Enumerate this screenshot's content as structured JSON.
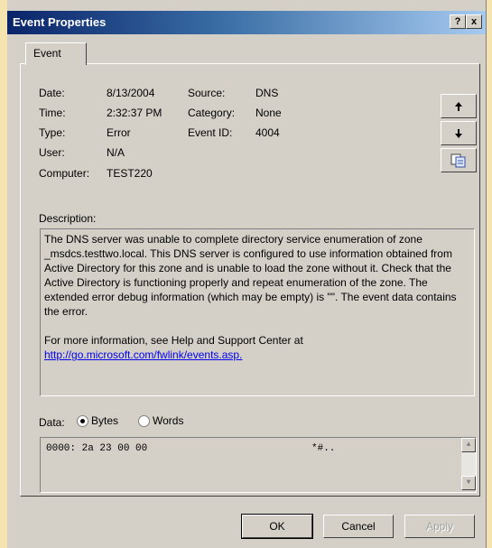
{
  "window": {
    "title": "Event Properties",
    "help_label": "?",
    "close_label": "x"
  },
  "tabs": [
    {
      "label": "Event"
    }
  ],
  "event": {
    "date_label": "Date:",
    "date": "8/13/2004",
    "time_label": "Time:",
    "time": "2:32:37 PM",
    "type_label": "Type:",
    "type": "Error",
    "user_label": "User:",
    "user": "N/A",
    "computer_label": "Computer:",
    "computer": "TEST220",
    "source_label": "Source:",
    "source": "DNS",
    "category_label": "Category:",
    "category": "None",
    "event_id_label": "Event ID:",
    "event_id": "4004"
  },
  "description": {
    "label": "Description:",
    "text": "The DNS server was unable to complete directory service enumeration of zone _msdcs.testtwo.local.  This DNS server is configured to use information obtained from Active Directory for this zone and is unable to load the zone without it.  Check that the Active Directory is functioning properly and repeat enumeration of the zone. The extended error debug information (which may be empty) is \"\". The event data contains the error.",
    "more_info": "For more information, see Help and Support Center at",
    "link": "http://go.microsoft.com/fwlink/events.asp."
  },
  "data": {
    "label": "Data:",
    "bytes_label": "Bytes",
    "words_label": "Words",
    "selected": "Bytes",
    "line": "0000: 2a 23 00 00",
    "ascii": "*#.."
  },
  "buttons": {
    "ok": "OK",
    "cancel": "Cancel",
    "apply": "Apply"
  },
  "icons": [
    "arrow-up-icon",
    "arrow-down-icon",
    "copy-icon"
  ]
}
